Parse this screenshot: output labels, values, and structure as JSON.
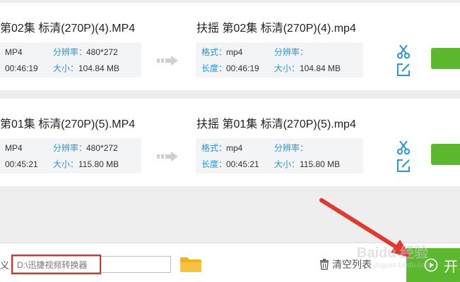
{
  "files": [
    {
      "source": {
        "name": "第02集 标清(270P)(4).MP4",
        "format": "MP4",
        "resolution_label": "分辨率：",
        "resolution": "480*272",
        "duration": "00:46:19",
        "size_label": "大小：",
        "size": "104.84 MB"
      },
      "output": {
        "name": "扶摇 第02集 标清(270P)(4).mp4",
        "format_label": "格式：",
        "format": "mp4",
        "resolution_label": "分辨率：",
        "length_label": "长度：",
        "duration": "00:46:19",
        "size_label": "大小：",
        "size": "104.84 MB"
      }
    },
    {
      "source": {
        "name": "第01集 标清(270P)(5).MP4",
        "format": "MP4",
        "resolution_label": "分辨率：",
        "resolution": "480*272",
        "duration": "00:45:21",
        "size_label": "大小：",
        "size": "115.80 MB"
      },
      "output": {
        "name": "扶摇 第01集 标清(270P)(5).mp4",
        "format_label": "格式：",
        "format": "mp4",
        "resolution_label": "分辨率：",
        "length_label": "长度：",
        "duration": "00:45:21",
        "size_label": "大小：",
        "size": "115.80 MB"
      }
    }
  ],
  "bottom_bar": {
    "output_label_fragment": "义",
    "output_path": "D:\\迅捷视频转换器",
    "clear_list_label": "清空列表",
    "start_label": "开"
  },
  "watermark": {
    "text": "Baidu 经验",
    "url": "jingyan.baidu.com"
  },
  "colors": {
    "accent_green": "#5cb82f",
    "label_blue": "#2c95d4",
    "highlight_red": "#d9302a"
  },
  "icons": {
    "cut": "scissors-icon",
    "edit": "edit-icon",
    "convert_arrow": "arrow-right-icon",
    "folder": "folder-icon",
    "trash": "trash-icon",
    "play": "play-circle-icon"
  }
}
